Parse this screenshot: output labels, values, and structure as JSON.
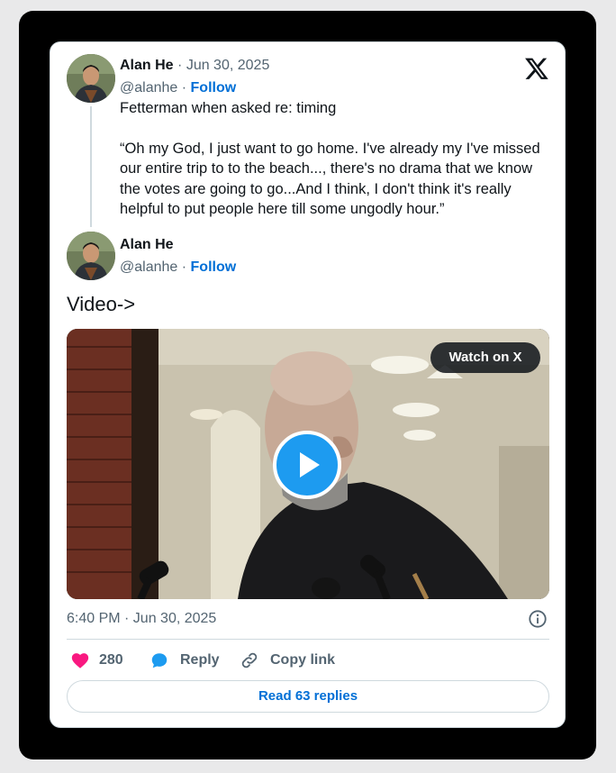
{
  "tweet": {
    "author_name": "Alan He",
    "date": "Jun 30, 2025",
    "handle": "@alanhe",
    "follow_label": "Follow",
    "text_line1": "Fetterman when asked re: timing",
    "text_quote": "“Oh my God, I just want to go home. I've already my I've missed our entire trip to to the beach..., there's no drama that we know the votes are going to go...And I think, I don't think it's really helpful to put people here till some ungodly hour.”"
  },
  "reply_tweet": {
    "author_name": "Alan He",
    "handle": "@alanhe",
    "follow_label": "Follow",
    "text": "Video->"
  },
  "video": {
    "watch_label": "Watch on X"
  },
  "footer": {
    "timestamp": "6:40 PM · Jun 30, 2025",
    "like_count": "280",
    "reply_label": "Reply",
    "copy_link_label": "Copy link",
    "read_replies_label": "Read 63 replies"
  },
  "colors": {
    "accent": "#1d9bf0",
    "link": "#006fd6",
    "like": "#f91880",
    "muted": "#536471"
  },
  "icons": [
    "x-logo-icon",
    "play-icon",
    "info-icon",
    "heart-icon",
    "reply-bubble-icon",
    "link-icon"
  ]
}
